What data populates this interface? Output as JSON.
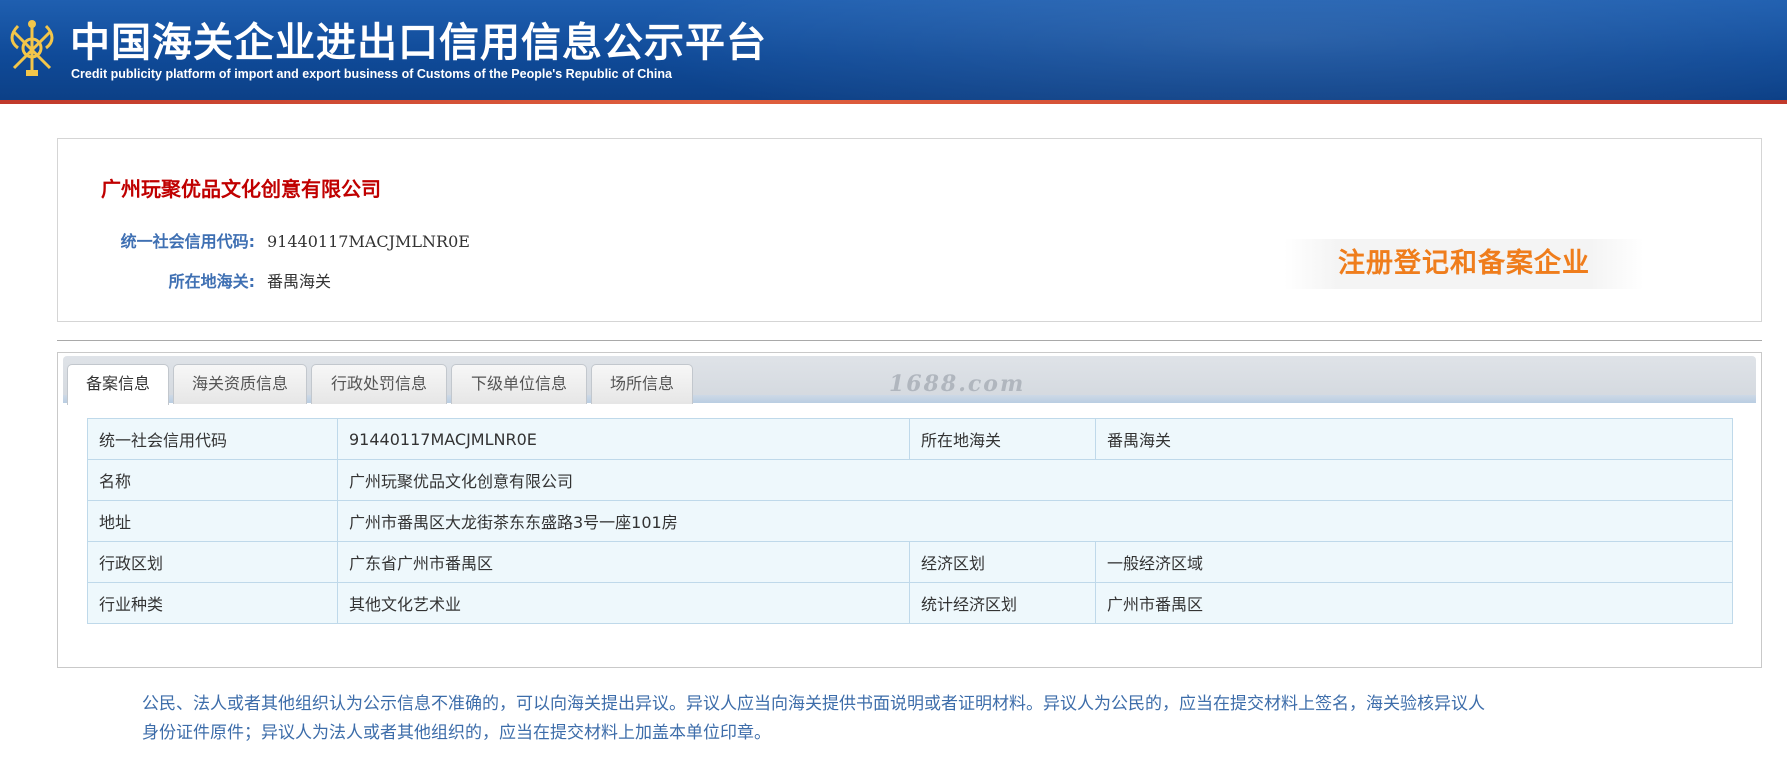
{
  "header": {
    "title": "中国海关企业进出口信用信息公示平台",
    "subtitle": "Credit publicity platform of import and export business of Customs of the People's Republic of China",
    "brand_color": "#0f4a98",
    "accent_line_color": "#c0392b",
    "emblem_icon": "customs-emblem-icon"
  },
  "company": {
    "name": "广州玩聚优品文化创意有限公司",
    "credit_code_label": "统一社会信用代码:",
    "credit_code": "91440117MACJMLNR0E",
    "customs_label": "所在地海关:",
    "customs": "番禺海关",
    "status_badge": "注册登记和备案企业",
    "name_color": "#c00000",
    "badge_color": "#ef7d1c"
  },
  "tabs": [
    {
      "label": "备案信息",
      "active": true
    },
    {
      "label": "海关资质信息",
      "active": false
    },
    {
      "label": "行政处罚信息",
      "active": false
    },
    {
      "label": "下级单位信息",
      "active": false
    },
    {
      "label": "场所信息",
      "active": false
    }
  ],
  "watermark": "1688.com",
  "details": {
    "rows": [
      [
        "统一社会信用代码",
        "91440117MACJMLNR0E",
        "所在地海关",
        "番禺海关"
      ],
      [
        "名称",
        "广州玩聚优品文化创意有限公司"
      ],
      [
        "地址",
        "广州市番禺区大龙街茶东东盛路3号一座101房"
      ],
      [
        "行政区划",
        "广东省广州市番禺区",
        "经济区划",
        "一般经济区域"
      ],
      [
        "行业种类",
        "其他文化艺术业",
        "统计经济区划",
        "广州市番禺区"
      ]
    ]
  },
  "notice": {
    "line1": "公民、法人或者其他组织认为公示信息不准确的，可以向海关提出异议。异议人应当向海关提供书面说明或者证明材料。异议人为公民的，应当在提交材料上签名，海关验核异议人",
    "line2": "身份证件原件；异议人为法人或者其他组织的，应当在提交材料上加盖本单位印章。"
  }
}
